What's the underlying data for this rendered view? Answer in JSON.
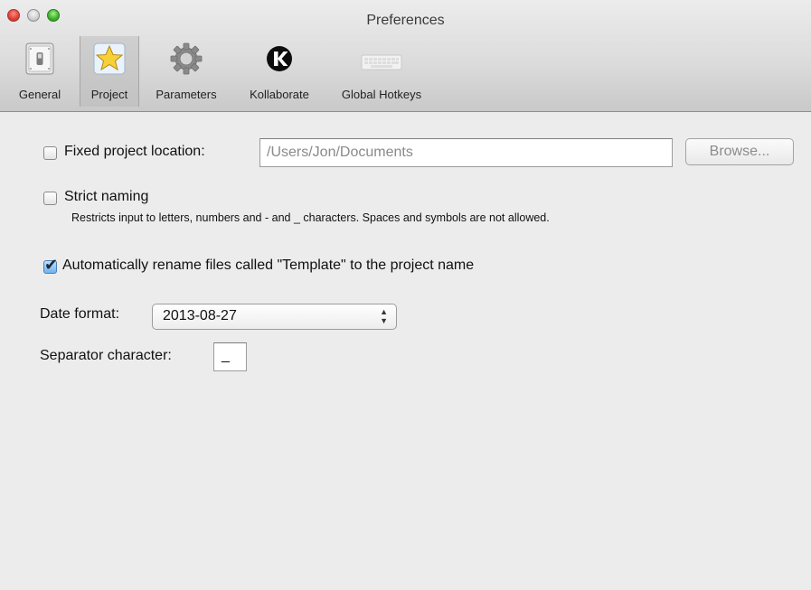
{
  "window": {
    "title": "Preferences"
  },
  "toolbar": {
    "items": [
      {
        "label": "General",
        "icon": "switch-icon",
        "selected": false
      },
      {
        "label": "Project",
        "icon": "star-icon",
        "selected": true
      },
      {
        "label": "Parameters",
        "icon": "gear-icon",
        "selected": false
      },
      {
        "label": "Kollaborate",
        "icon": "kollaborate-logo-icon",
        "selected": false
      },
      {
        "label": "Global Hotkeys",
        "icon": "keyboard-icon",
        "selected": false
      }
    ]
  },
  "project": {
    "fixed_location": {
      "label": "Fixed project location:",
      "checked": false,
      "path_value": "/Users/Jon/Documents",
      "browse_label": "Browse..."
    },
    "strict_naming": {
      "label": "Strict naming",
      "checked": false,
      "description": "Restricts input to letters, numbers and - and _ characters. Spaces and symbols are not allowed."
    },
    "auto_rename": {
      "label": "Automatically rename files called \"Template\" to the project name",
      "checked": true
    },
    "date_format": {
      "label": "Date format:",
      "selected": "2013-08-27"
    },
    "separator": {
      "label": "Separator character:",
      "value": "_"
    }
  },
  "colors": {
    "checkbox_checked": "#6fb2ee",
    "close_button": "#e0443b",
    "zoom_button": "#42b52d"
  }
}
